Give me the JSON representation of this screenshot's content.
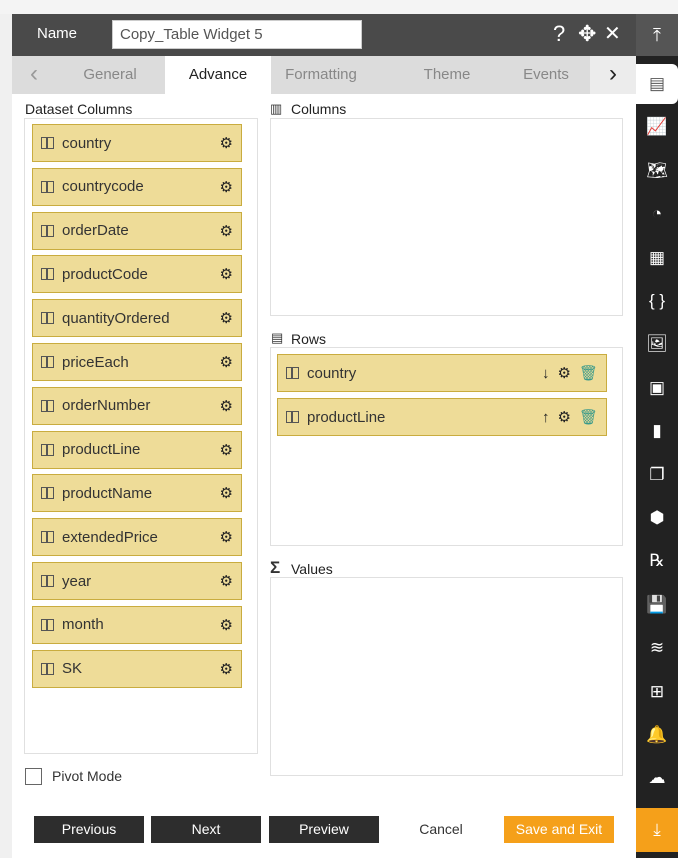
{
  "header": {
    "name_label": "Name",
    "name_value": "Copy_Table Widget 5",
    "help_icon": "?",
    "move_icon": "✥",
    "close_icon": "✕"
  },
  "tabs": [
    {
      "label": "General"
    },
    {
      "label": "Advance",
      "active": true
    },
    {
      "label": "Formatting"
    },
    {
      "label": "Theme"
    },
    {
      "label": "Events"
    }
  ],
  "dataset": {
    "title": "Dataset Columns",
    "columns": [
      "country",
      "countrycode",
      "orderDate",
      "productCode",
      "quantityOrdered",
      "priceEach",
      "orderNumber",
      "productLine",
      "productName",
      "extendedPrice",
      "year",
      "month",
      "SK"
    ]
  },
  "columns": {
    "title": "Columns"
  },
  "rows": {
    "title": "Rows",
    "items": [
      {
        "label": "country",
        "sort": "↓"
      },
      {
        "label": "productLine",
        "sort": "↑"
      }
    ]
  },
  "values": {
    "title": "Values"
  },
  "pivot_mode": {
    "label": "Pivot Mode",
    "checked": false
  },
  "buttons": {
    "previous": "Previous",
    "next": "Next",
    "preview": "Preview",
    "cancel": "Cancel",
    "save": "Save and Exit"
  },
  "colors": {
    "accent": "#f5a01a",
    "header": "#4a4a4a",
    "item_bg": "#eedc98",
    "sidebar": "#222222"
  },
  "sidebar_icons": [
    "table-icon",
    "line-chart-icon",
    "map-icon",
    "pie-doc-icon",
    "document-icon",
    "braces-icon",
    "image-icon",
    "layout-icon",
    "bar-chart-icon",
    "copy-icon",
    "cubes-icon",
    "rx-icon",
    "save-icon",
    "layers-icon",
    "add-widget-icon",
    "alert-icon",
    "cloud-upload-icon"
  ]
}
